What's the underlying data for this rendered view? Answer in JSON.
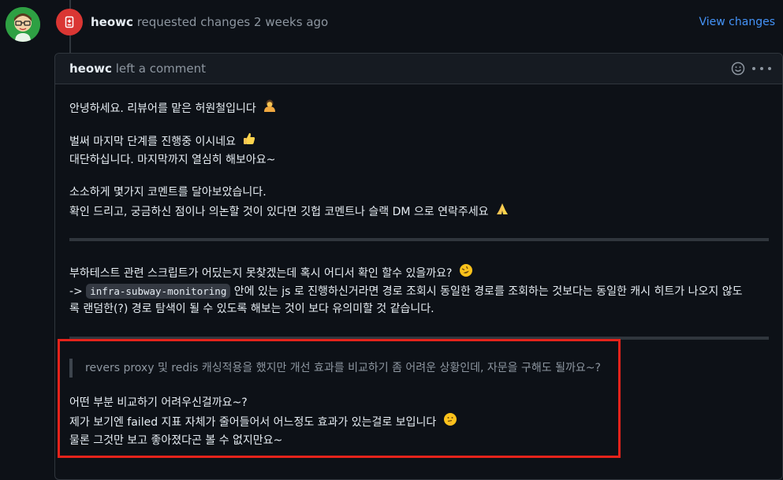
{
  "review_event": {
    "author": "heowc",
    "action_text": "requested changes 2 weeks ago",
    "view_changes_label": "View changes"
  },
  "comment": {
    "header": {
      "author": "heowc",
      "action_text": "left a comment"
    },
    "paragraphs": {
      "p1": "안녕하세요. 리뷰어를 맡은 허원철입니다",
      "p2_line1": "벌써 마지막 단계를 진행중 이시네요",
      "p2_line2": "대단하십니다. 마지막까지 열심히 해보아요~",
      "p3_line1": "소소하게 몇가지 코멘트를 달아보았습니다.",
      "p3_line2": "확인 드리고, 궁금하신 점이나 의논할 것이 있다면 깃헙 코멘트나 슬랙 DM 으로 연락주세요",
      "p4_line1": "부하테스트 관련 스크립트가 어딨는지 못찾겠는데 혹시 어디서 확인 할수 있을까요?",
      "p4_line2_prefix": "->",
      "p4_line2_code": "infra-subway-monitoring",
      "p4_line2_rest": "안에 있는 js 로 진행하신거라면 경로 조회시 동일한 경로를 조회하는 것보다는 동일한 캐시 히트가 나오지 않도",
      "p4_line3": "록 랜덤한(?) 경로 탐색이 될 수 있도록 해보는 것이 보다 유의미할 것 같습니다.",
      "quote": "revers proxy 및 redis 캐싱적용을 했지만 개선 효과를 비교하기 좀 어려운 상황인데, 자문을 구해도 될까요~?",
      "p5_line1": "어떤 부분 비교하기 어려우신걸까요~?",
      "p5_line2": "제가 보기엔 failed 지표 자체가 줄어들어서 어느정도 효과가 있는걸로 보입니다",
      "p5_line3": "물론 그것만 보고 좋아졌다곤 볼 수 없지만요~"
    },
    "emojis": [
      "woman-bowing",
      "thumbs-up",
      "folded-hands",
      "rolling-on-floor-laughing",
      "thinking-face"
    ]
  },
  "colors": {
    "background": "#0d1117",
    "header_bg": "#161b22",
    "border": "#30363d",
    "link": "#4493f8",
    "changes_requested": "#da3633",
    "highlight": "#e5231b"
  }
}
